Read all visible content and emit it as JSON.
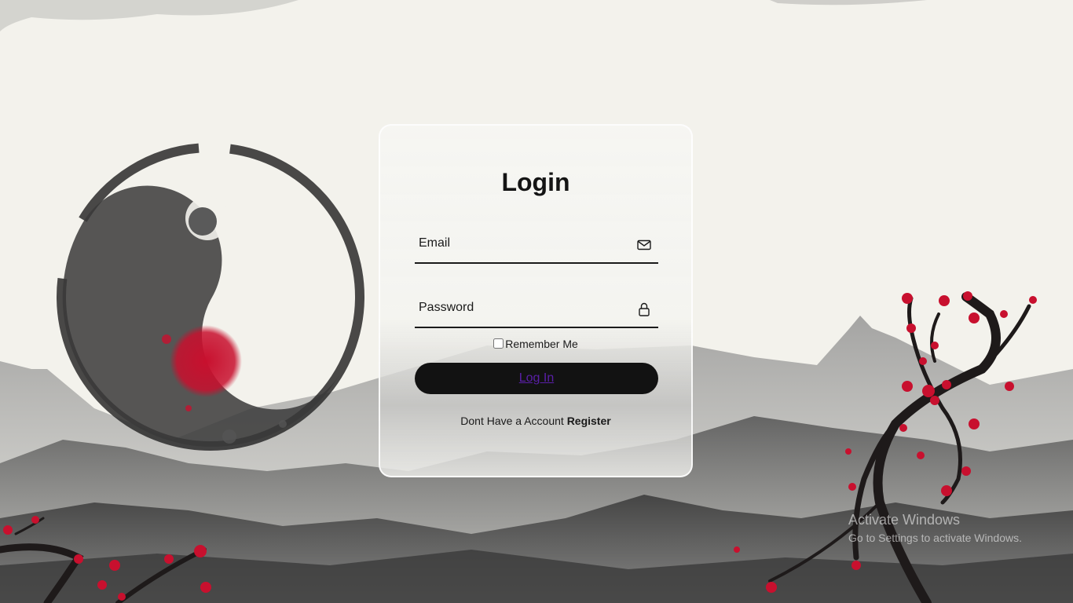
{
  "login": {
    "title": "Login",
    "email_placeholder": "Email",
    "email_icon": "envelope-icon",
    "password_placeholder": "Password",
    "password_icon": "lock-icon",
    "remember_label": "Remember Me",
    "submit_label": "Log In",
    "no_account_text": "Dont Have a Account",
    "register_link": "Register"
  },
  "watermark": {
    "title": "Activate Windows",
    "subtitle": "Go to Settings to activate Windows."
  },
  "colors": {
    "background": "#f3f2ec",
    "button": "#121212",
    "button_text": "#5a1fa8",
    "blossom": "#c8102e",
    "ink": "#1a1a1a"
  }
}
